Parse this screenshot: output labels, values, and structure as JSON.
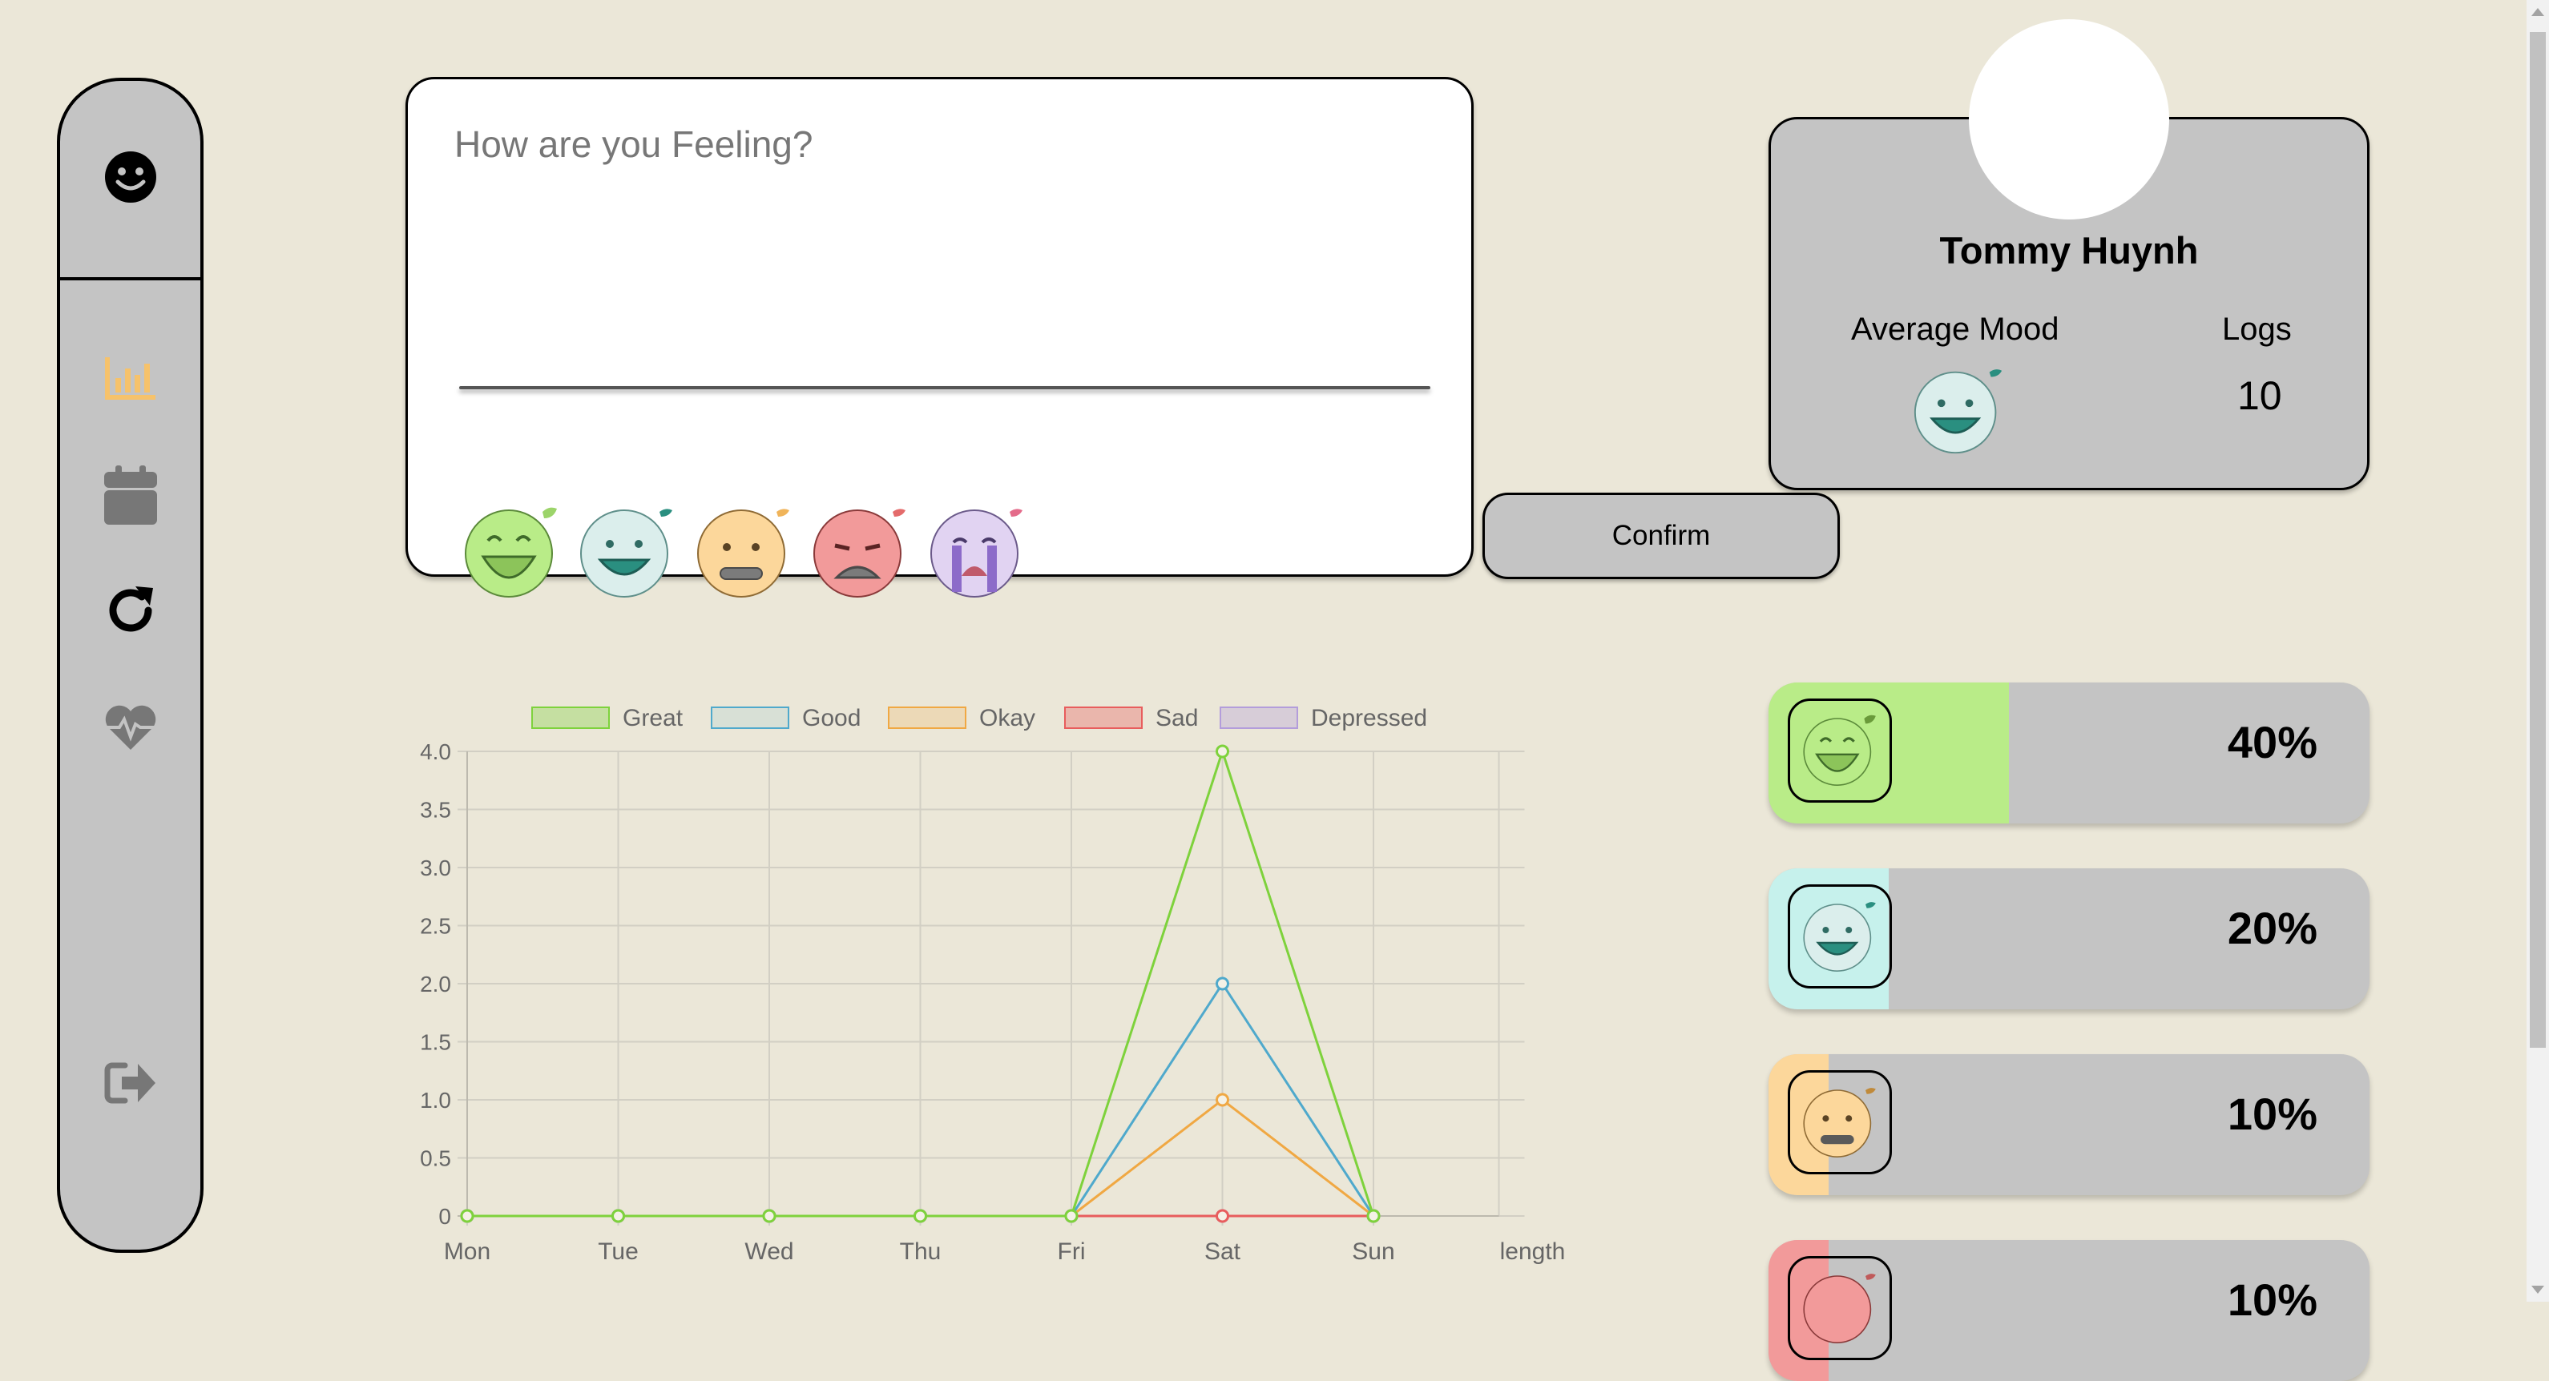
{
  "nav": {
    "items": [
      {
        "name": "dashboard",
        "icon": "smile-icon"
      },
      {
        "name": "stats",
        "icon": "bar-chart-icon",
        "color": "#f6c26b"
      },
      {
        "name": "calendar",
        "icon": "calendar-icon",
        "color": "#777777"
      },
      {
        "name": "refresh",
        "icon": "refresh-icon",
        "color": "#000000"
      },
      {
        "name": "health",
        "icon": "heart-pulse-icon",
        "color": "#777777"
      },
      {
        "name": "logout",
        "icon": "logout-icon",
        "color": "#777777"
      }
    ]
  },
  "entry": {
    "placeholder": "How are you Feeling?",
    "confirm_label": "Confirm",
    "moods": [
      "Great",
      "Good",
      "Okay",
      "Sad",
      "Depressed"
    ]
  },
  "colors": {
    "great": "#b9ec88",
    "good": "#c6f1ec",
    "okay": "#fcd79b",
    "sad": "#f29a9a",
    "depressed": "#d6c3ec",
    "panel": "#c4c4c4",
    "background": "#ebe7d8"
  },
  "profile": {
    "name": "Tommy Huynh",
    "average_mood_label": "Average Mood",
    "average_mood": "Good",
    "logs_label": "Logs",
    "logs_value": "10"
  },
  "mood_breakdown": [
    {
      "mood": "Great",
      "percent_label": "40%",
      "fraction": 0.4
    },
    {
      "mood": "Good",
      "percent_label": "20%",
      "fraction": 0.2
    },
    {
      "mood": "Okay",
      "percent_label": "10%",
      "fraction": 0.1
    },
    {
      "mood": "Sad",
      "percent_label": "10%",
      "fraction": 0.1
    }
  ],
  "chart_data": {
    "type": "line",
    "categories": [
      "Mon",
      "Tue",
      "Wed",
      "Thu",
      "Fri",
      "Sat",
      "Sun",
      "length"
    ],
    "ylim": [
      0,
      4
    ],
    "yticks": [
      "0",
      "0.5",
      "1.0",
      "1.5",
      "2.0",
      "2.5",
      "3.0",
      "3.5",
      "4.0"
    ],
    "grid": true,
    "legend_position": "top",
    "series": [
      {
        "name": "Great",
        "color": "#7ed23c",
        "values": [
          0,
          0,
          0,
          0,
          0,
          4,
          0
        ]
      },
      {
        "name": "Good",
        "color": "#4fa9cc",
        "values": [
          0,
          0,
          0,
          0,
          0,
          2,
          0
        ]
      },
      {
        "name": "Okay",
        "color": "#f0a843",
        "values": [
          0,
          0,
          0,
          0,
          0,
          1,
          0
        ]
      },
      {
        "name": "Sad",
        "color": "#e85d5d",
        "values": [
          0,
          0,
          0,
          0,
          0,
          0,
          0
        ]
      },
      {
        "name": "Depressed",
        "color": "#b39ddb",
        "values": [
          0,
          0,
          0,
          0,
          0,
          0,
          0
        ]
      }
    ]
  }
}
